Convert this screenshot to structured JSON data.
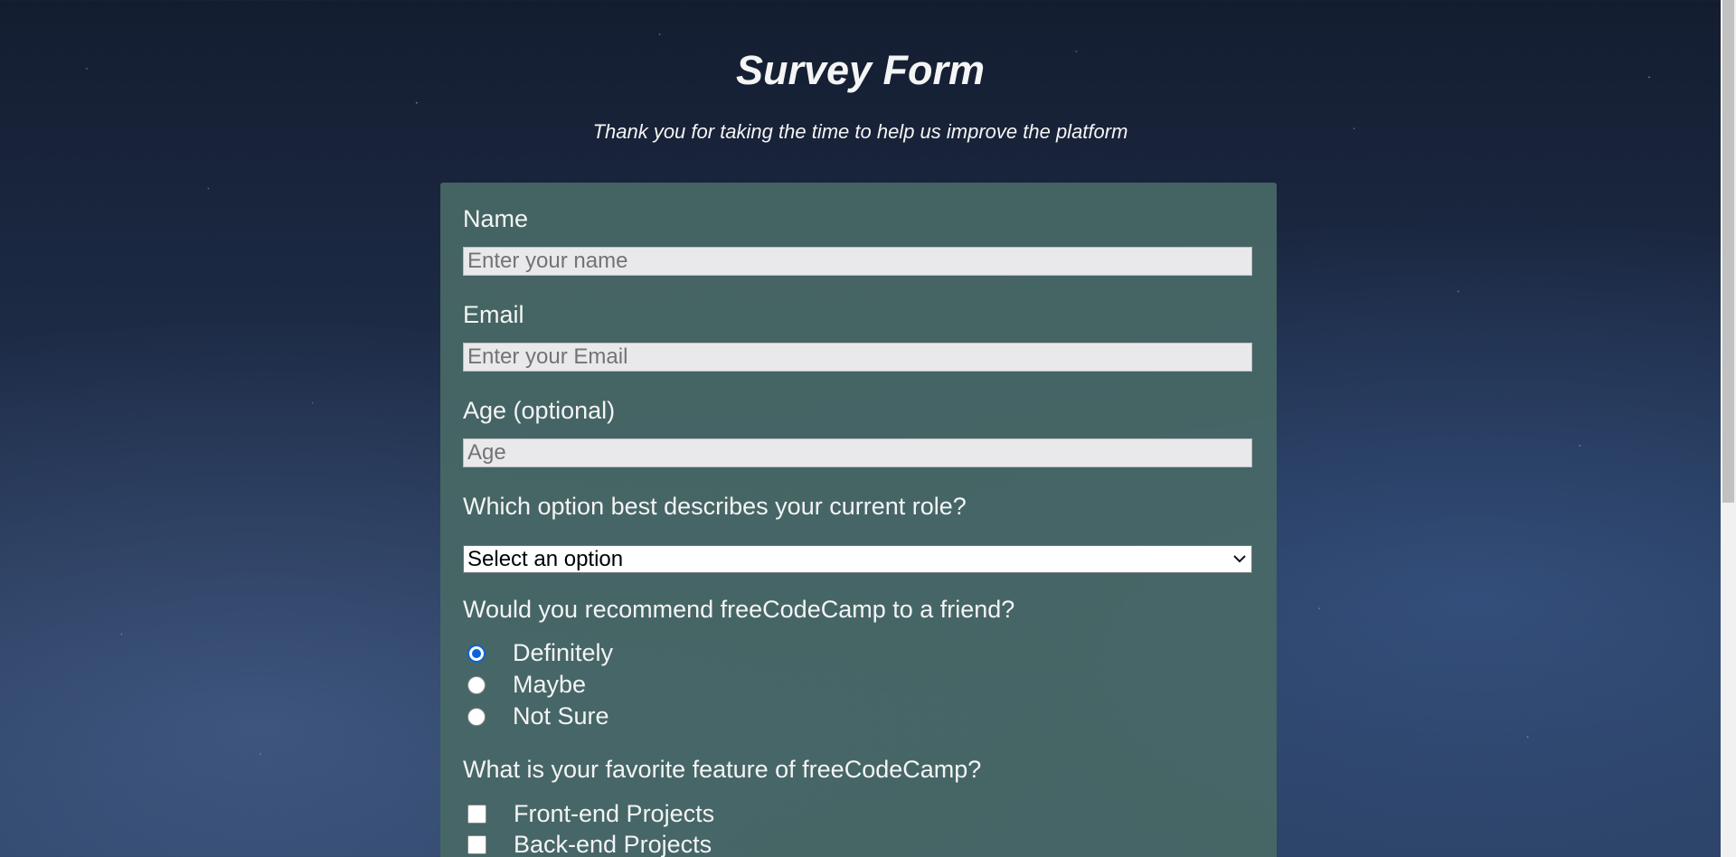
{
  "header": {
    "title": "Survey Form",
    "description": "Thank you for taking the time to help us improve the platform"
  },
  "form": {
    "name": {
      "label": "Name",
      "placeholder": "Enter your name",
      "value": ""
    },
    "email": {
      "label": "Email",
      "placeholder": "Enter your Email",
      "value": ""
    },
    "age": {
      "label": "Age (optional)",
      "placeholder": "Age",
      "value": ""
    },
    "role": {
      "label": "Which option best describes your current role?",
      "selected": "Select an option"
    },
    "recommend": {
      "label": "Would you recommend freeCodeCamp to a friend?",
      "options": [
        {
          "label": "Definitely",
          "checked": true
        },
        {
          "label": "Maybe",
          "checked": false
        },
        {
          "label": "Not Sure",
          "checked": false
        }
      ]
    },
    "feature": {
      "label": "What is your favorite feature of freeCodeCamp?",
      "options": [
        {
          "label": "Front-end Projects",
          "checked": false
        },
        {
          "label": "Back-end Projects",
          "checked": false
        }
      ]
    }
  },
  "colors": {
    "card": "#486866",
    "radio_accent": "#0b63d6"
  },
  "icons": {
    "select_chevron": "chevron-down-icon"
  }
}
